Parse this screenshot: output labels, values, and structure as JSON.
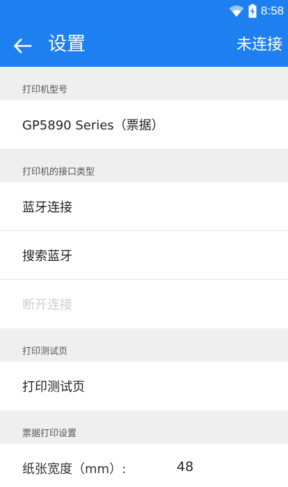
{
  "status": {
    "time": "8:58"
  },
  "appbar": {
    "title": "设置",
    "connection_status": "未连接"
  },
  "sections": {
    "printer_model": {
      "header": "打印机型号",
      "model": "GP5890 Series（票据）"
    },
    "interface": {
      "header": "打印机的接口类型",
      "bluetooth_connect": "蓝牙连接",
      "search_bluetooth": "搜索蓝牙",
      "disconnect": "断开连接"
    },
    "test_page": {
      "header": "打印测试页",
      "print_test": "打印测试页"
    },
    "receipt": {
      "header": "票据打印设置",
      "paper_width_label": "纸张宽度（mm）:",
      "paper_width_value": "48"
    }
  },
  "colors": {
    "primary": "#1e80f0",
    "background": "#efefef"
  }
}
